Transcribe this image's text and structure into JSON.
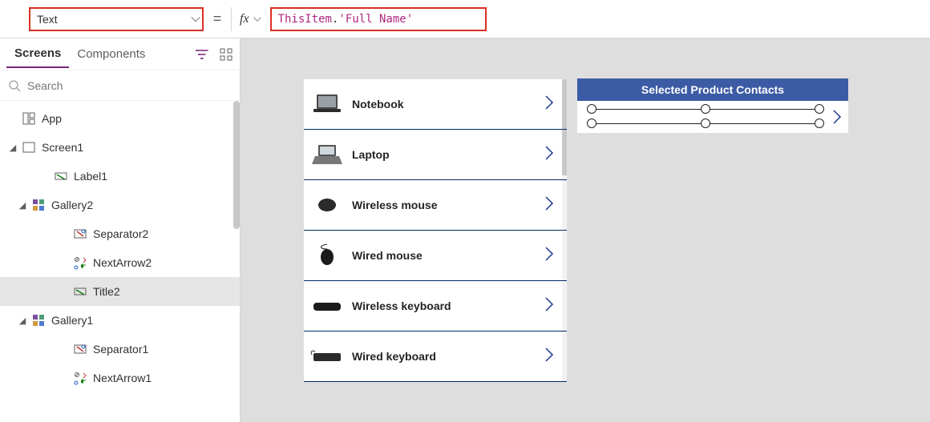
{
  "formula_bar": {
    "property": "Text",
    "formula_this": "ThisItem",
    "formula_dot": ".",
    "formula_field": "'Full Name'"
  },
  "tabs": {
    "screens": "Screens",
    "components": "Components"
  },
  "search": {
    "placeholder": "Search"
  },
  "tree": [
    {
      "id": "app",
      "label": "App",
      "indent": 0,
      "icon": "app",
      "expandable": false
    },
    {
      "id": "screen1",
      "label": "Screen1",
      "indent": 0,
      "icon": "screen",
      "expandable": true,
      "expanded": true
    },
    {
      "id": "label1",
      "label": "Label1",
      "indent": 2,
      "icon": "label",
      "expandable": false
    },
    {
      "id": "gallery2",
      "label": "Gallery2",
      "indent": 1,
      "icon": "gallery",
      "expandable": true,
      "expanded": true
    },
    {
      "id": "separator2",
      "label": "Separator2",
      "indent": 3,
      "icon": "separator",
      "expandable": false
    },
    {
      "id": "nextarrow2",
      "label": "NextArrow2",
      "indent": 3,
      "icon": "iconctrl",
      "expandable": false
    },
    {
      "id": "title2",
      "label": "Title2",
      "indent": 3,
      "icon": "label",
      "expandable": false,
      "selected": true
    },
    {
      "id": "gallery1",
      "label": "Gallery1",
      "indent": 1,
      "icon": "gallery",
      "expandable": true,
      "expanded": true
    },
    {
      "id": "separator1",
      "label": "Separator1",
      "indent": 3,
      "icon": "separator",
      "expandable": false
    },
    {
      "id": "nextarrow1",
      "label": "NextArrow1",
      "indent": 3,
      "icon": "iconctrl",
      "expandable": false
    }
  ],
  "products": [
    {
      "name": "Notebook",
      "img": "notebook"
    },
    {
      "name": "Laptop",
      "img": "laptop"
    },
    {
      "name": "Wireless mouse",
      "img": "mouse"
    },
    {
      "name": "Wired mouse",
      "img": "mouse2"
    },
    {
      "name": "Wireless keyboard",
      "img": "keyboard"
    },
    {
      "name": "Wired keyboard",
      "img": "keyboard2"
    }
  ],
  "header2": "Selected Product Contacts"
}
